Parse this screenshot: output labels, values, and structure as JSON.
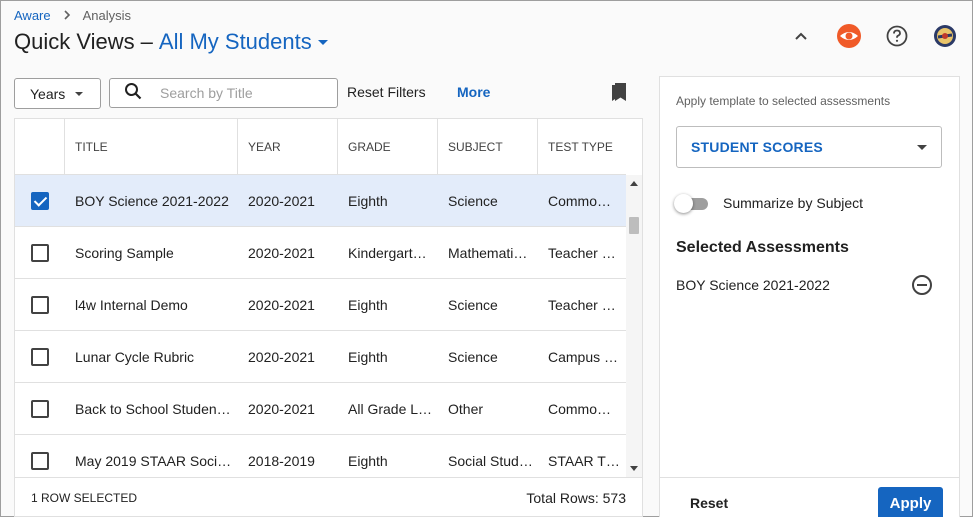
{
  "breadcrumb": {
    "root": "Aware",
    "current": "Analysis"
  },
  "title": {
    "main": "Quick Views",
    "separator": "–",
    "view": "All My Students"
  },
  "header_icons": [
    "chevron-up-icon",
    "aware-eye-icon",
    "help-icon",
    "avatar"
  ],
  "toolbar": {
    "years_label": "Years",
    "search_placeholder": "Search by Title",
    "reset_filters": "Reset Filters",
    "more": "More"
  },
  "table": {
    "columns": [
      "TITLE",
      "YEAR",
      "GRADE",
      "SUBJECT",
      "TEST TYPE"
    ],
    "rows": [
      {
        "checked": true,
        "title": "BOY Science 2021-2022",
        "year": "2020-2021",
        "grade": "Eighth",
        "subject": "Science",
        "type": "Commo…"
      },
      {
        "checked": false,
        "title": "Scoring Sample",
        "year": "2020-2021",
        "grade": "Kindergart…",
        "subject": "Mathemati…",
        "type": "Teacher …"
      },
      {
        "checked": false,
        "title": "l4w Internal Demo",
        "year": "2020-2021",
        "grade": "Eighth",
        "subject": "Science",
        "type": "Teacher …"
      },
      {
        "checked": false,
        "title": "Lunar Cycle Rubric",
        "year": "2020-2021",
        "grade": "Eighth",
        "subject": "Science",
        "type": "Campus …"
      },
      {
        "checked": false,
        "title": "Back to School Studen…",
        "year": "2020-2021",
        "grade": "All Grade L…",
        "subject": "Other",
        "type": "Commo…"
      },
      {
        "checked": false,
        "title": "May 2019 STAAR Soci…",
        "year": "2018-2019",
        "grade": "Eighth",
        "subject": "Social Stud…",
        "type": "STAAR T…"
      }
    ],
    "footer": {
      "rows_selected": "1 ROW SELECTED",
      "total_rows": "Total Rows: 573"
    }
  },
  "panel": {
    "hint": "Apply template to selected assessments",
    "template_value": "STUDENT SCORES",
    "summarize_label": "Summarize by Subject",
    "summarize_on": false,
    "selected_heading": "Selected Assessments",
    "selected_items": [
      "BOY Science 2021-2022"
    ],
    "reset": "Reset",
    "apply": "Apply"
  },
  "colors": {
    "accent": "#1565c0",
    "selected_row": "#e3ecfa",
    "brand_orange": "#f05a28"
  }
}
